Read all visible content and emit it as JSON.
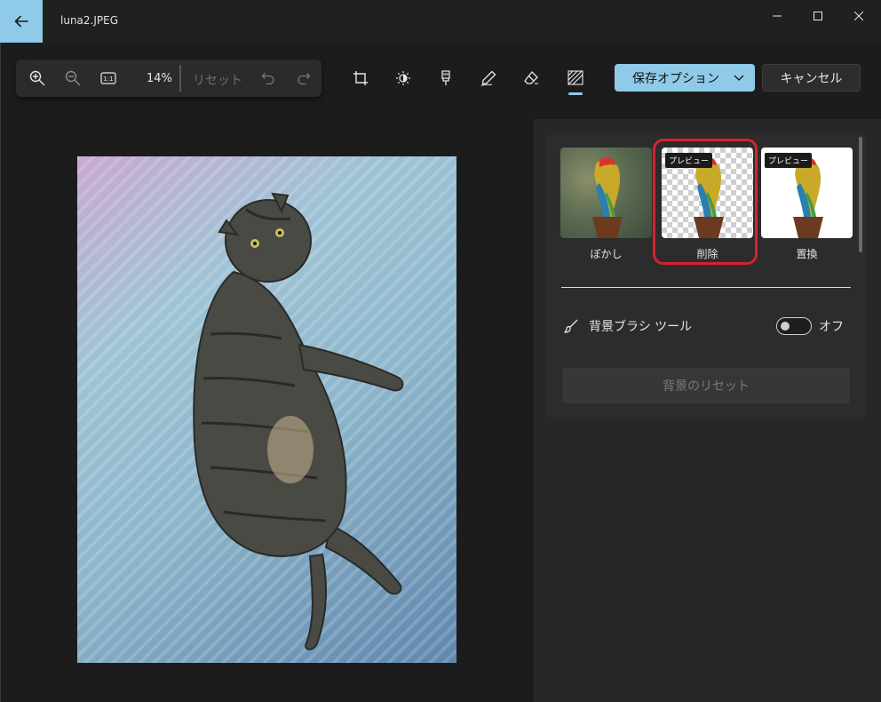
{
  "window": {
    "title": "luna2.JPEG"
  },
  "toolbar": {
    "zoom_percent": "14%",
    "reset_label": "リセット",
    "tools": [
      "crop-icon",
      "brightness-icon",
      "filter-icon",
      "markup-icon",
      "erase-icon",
      "background-icon"
    ],
    "active_tool": "background-icon"
  },
  "actions": {
    "save_label": "保存オプション",
    "cancel_label": "キャンセル"
  },
  "panel": {
    "options": [
      {
        "label": "ぼかし",
        "badge": ""
      },
      {
        "label": "削除",
        "badge": "プレビュー"
      },
      {
        "label": "置換",
        "badge": "プレビュー"
      }
    ],
    "highlighted_option": "削除",
    "brush_tool_label": "背景ブラシ ツール",
    "brush_toggle_state": "オフ",
    "reset_background_label": "背景のリセット"
  },
  "colors": {
    "accent": "#8fcbe8",
    "highlight": "#d6222d",
    "background": "#1c1c1c"
  }
}
